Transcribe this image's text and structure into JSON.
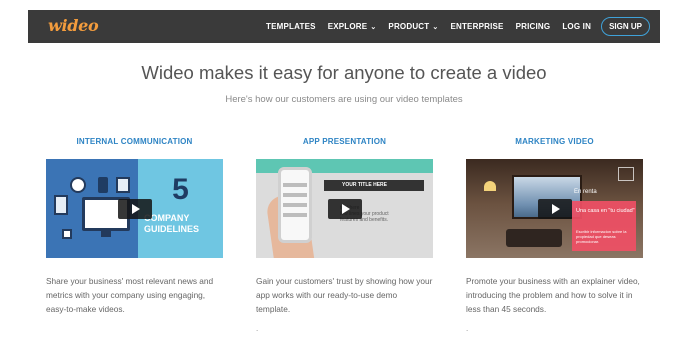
{
  "brand": {
    "logo": "wideo",
    "accent": "#f39c3d",
    "link_color": "#2e84c4"
  },
  "nav": {
    "items": [
      {
        "label": "TEMPLATES",
        "dropdown": false
      },
      {
        "label": "EXPLORE",
        "dropdown": true
      },
      {
        "label": "PRODUCT",
        "dropdown": true
      },
      {
        "label": "ENTERPRISE",
        "dropdown": false
      },
      {
        "label": "PRICING",
        "dropdown": false
      },
      {
        "label": "LOG IN",
        "dropdown": false
      }
    ],
    "signup": "SIGN UP"
  },
  "hero": {
    "title": "Wideo makes it easy for anyone to create a video",
    "subtitle": "Here's how our customers are using our video templates"
  },
  "cards": [
    {
      "title": "INTERNAL COMMUNICATION",
      "thumb": {
        "number": "5",
        "label_line1": "COMPANY",
        "label_line2": "GUIDELINES"
      },
      "desc": "Share your business' most relevant news and metrics with your company using engaging, easy-to-make videos."
    },
    {
      "title": "APP PRESENTATION",
      "thumb": {
        "bar_text": "YOUR TITLE HERE",
        "line1": "text here",
        "line2": "few lines your product",
        "line3": "features and benefits."
      },
      "desc": "Gain your customers' trust by showing how your app works with our ready-to-use demo template.",
      "dot": "."
    },
    {
      "title": "MARKETING VIDEO",
      "thumb": {
        "rent": "En renta",
        "box_title": "Una casa en \"tu ciudad\"",
        "box_text": "Escribir informacion sobre la propiedad que deseas promocionar."
      },
      "desc": "Promote your business with an explainer video, introducing the problem and how to solve it in less than 45 seconds.",
      "dot": "."
    }
  ]
}
